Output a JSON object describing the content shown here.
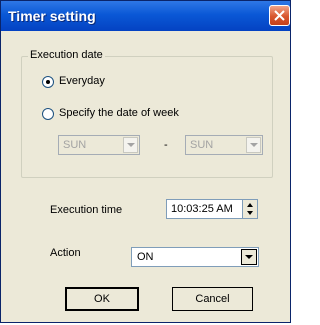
{
  "window": {
    "title": "Timer setting",
    "close_icon": "close-icon"
  },
  "execution_date": {
    "group_label": "Execution date",
    "everyday_label": "Everyday",
    "everyday_selected": true,
    "specify_label": "Specify the date of week",
    "specify_selected": false,
    "from_day": "SUN",
    "separator": "-",
    "to_day": "SUN"
  },
  "execution_time": {
    "label": "Execution time",
    "value": "10:03:25 AM"
  },
  "action": {
    "label": "Action",
    "value": "ON"
  },
  "buttons": {
    "ok_label": "OK",
    "cancel_label": "Cancel"
  }
}
